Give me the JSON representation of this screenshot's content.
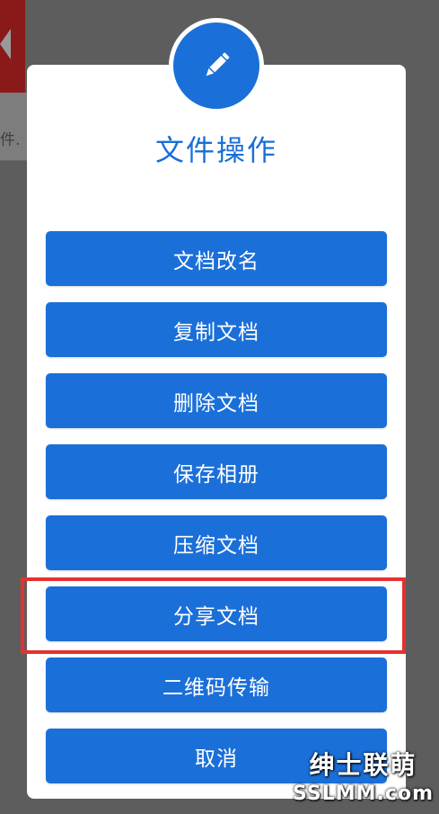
{
  "background": {
    "partial_text": "件.",
    "back_icon": "back-arrow-icon"
  },
  "dialog": {
    "icon": "pencil-icon",
    "title": "文件操作",
    "actions": [
      {
        "label": "文档改名"
      },
      {
        "label": "复制文档"
      },
      {
        "label": "删除文档"
      },
      {
        "label": "保存相册"
      },
      {
        "label": "压缩文档"
      },
      {
        "label": "分享文档"
      },
      {
        "label": "二维码传输"
      },
      {
        "label": "取消"
      }
    ],
    "highlighted_action": "分享文档"
  },
  "colors": {
    "accent": "#1b6fd8",
    "title": "#1a6fd6",
    "highlight": "#e5312f",
    "overlay": "#5d5d5d"
  },
  "watermark": {
    "line1": "绅士联萌",
    "line2": "SSLMM.com"
  }
}
